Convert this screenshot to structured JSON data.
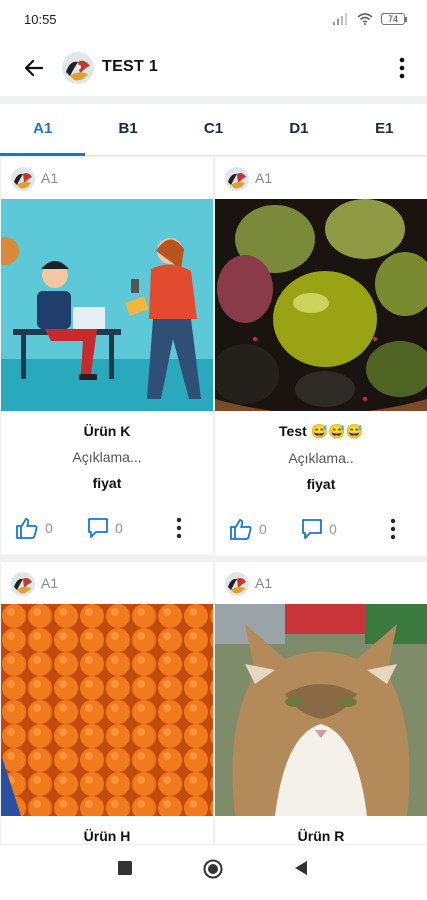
{
  "status_bar": {
    "time": "10:55",
    "battery": "74"
  },
  "app_bar": {
    "title": "TEST 1",
    "back_icon": "arrow-left-icon",
    "menu_icon": "more-vertical-icon"
  },
  "tabs": [
    {
      "label": "A1",
      "active": true
    },
    {
      "label": "B1",
      "active": false
    },
    {
      "label": "C1",
      "active": false
    },
    {
      "label": "D1",
      "active": false
    },
    {
      "label": "E1",
      "active": false
    }
  ],
  "cards": [
    {
      "category": "A1",
      "name": "Ürün K",
      "description": "Açıklama...",
      "price": "fiyat",
      "likes": "0",
      "comments": "0"
    },
    {
      "category": "A1",
      "name": "Test 😅😅😅",
      "description": "Açıklama..",
      "price": "fiyat",
      "likes": "0",
      "comments": "0"
    },
    {
      "category": "A1",
      "name": "Ürün H"
    },
    {
      "category": "A1",
      "name": "Ürün R"
    }
  ],
  "colors": {
    "accent": "#1976d2",
    "background": "#eef0f2"
  }
}
